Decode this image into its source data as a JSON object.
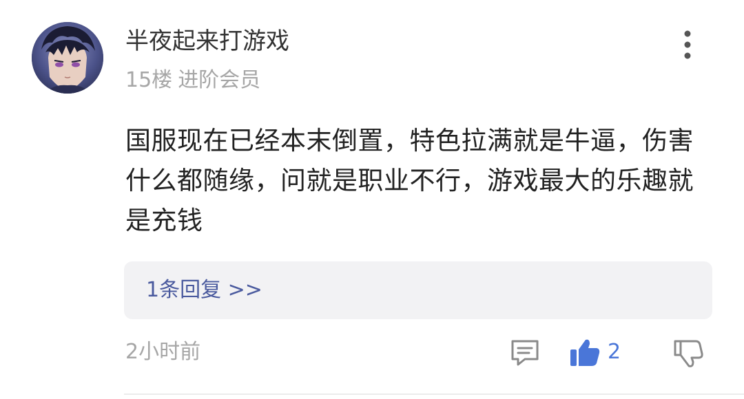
{
  "post": {
    "username": "半夜起来打游戏",
    "floor": "15楼",
    "member_level": "进阶会员",
    "content": "国服现在已经本末倒置，特色拉满就是牛逼，伤害什么都随缘，问就是职业不行，游戏最大的乐趣就是充钱",
    "reply_link": "1条回复 >>",
    "time": "2小时前",
    "like_count": "2"
  },
  "icons": {
    "more": "more-vertical-icon",
    "comment": "comment-icon",
    "like": "thumbs-up-icon",
    "dislike": "thumbs-down-icon"
  },
  "colors": {
    "text_primary": "#222222",
    "text_secondary": "#a6a6a6",
    "link": "#4a5a9e",
    "like_active": "#4a76d8",
    "reply_bg": "#f2f2f4"
  }
}
